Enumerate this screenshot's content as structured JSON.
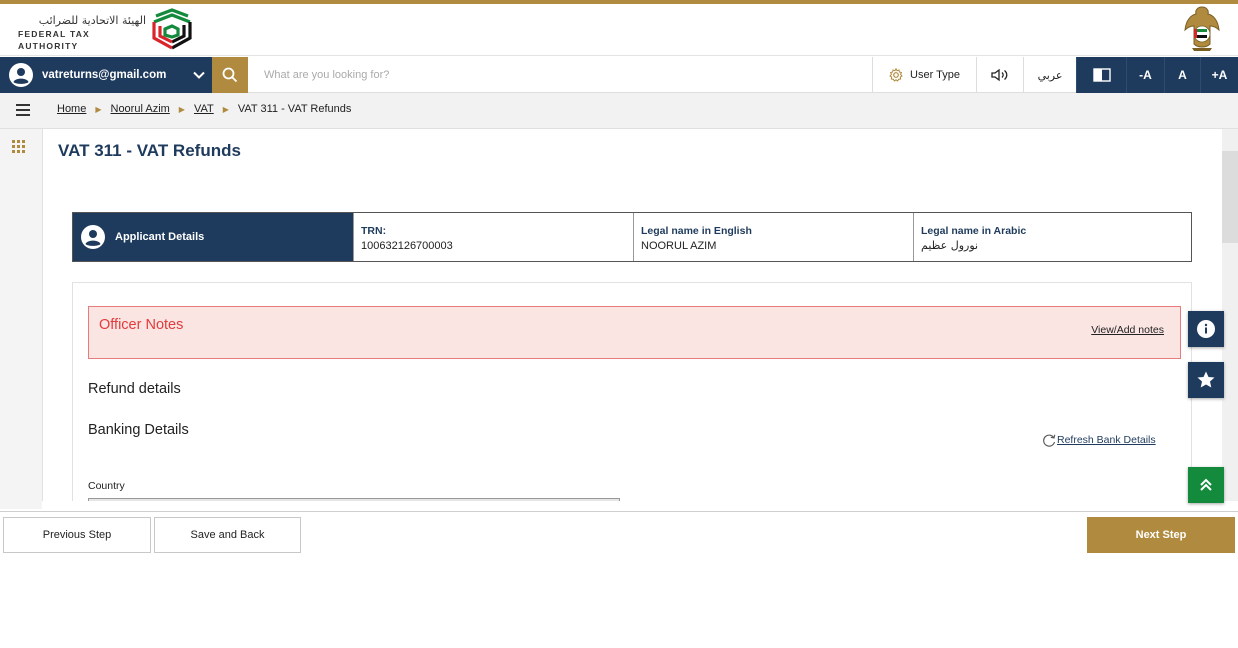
{
  "header": {
    "logo_arabic": "الهيئة الاتحادية للضرائب",
    "logo_english": "FEDERAL TAX AUTHORITY"
  },
  "toolbar": {
    "user_email": "vatreturns@gmail.com",
    "search_placeholder": "What are you looking for?",
    "user_type_label": "User Type",
    "language_label": "عربي",
    "font_decrease": "-A",
    "font_normal": "A",
    "font_increase": "+A"
  },
  "breadcrumb": {
    "items": [
      "Home",
      "Noorul Azim",
      "VAT"
    ],
    "current": "VAT 311 - VAT Refunds"
  },
  "page": {
    "title": "VAT 311 - VAT Refunds"
  },
  "applicant": {
    "heading": "Applicant Details",
    "columns": [
      {
        "label": "TRN:",
        "value": "100632126700003"
      },
      {
        "label": "Legal name in English",
        "value": "NOORUL AZIM"
      },
      {
        "label": "Legal name in Arabic",
        "value": "نورول عظيم"
      }
    ]
  },
  "officer_notes": {
    "title": "Officer Notes",
    "link": "View/Add notes"
  },
  "sections": {
    "refund_details": "Refund details",
    "banking_details": "Banking Details",
    "refresh_bank": "Refresh Bank Details",
    "country_label": "Country"
  },
  "footer": {
    "previous_step": "Previous Step",
    "save_and_back": "Save and Back",
    "next_step": "Next Step"
  },
  "colors": {
    "navy": "#1e3a5c",
    "gold": "#b08a3e",
    "notes_red": "#e23b3b",
    "green": "#138a3c"
  }
}
